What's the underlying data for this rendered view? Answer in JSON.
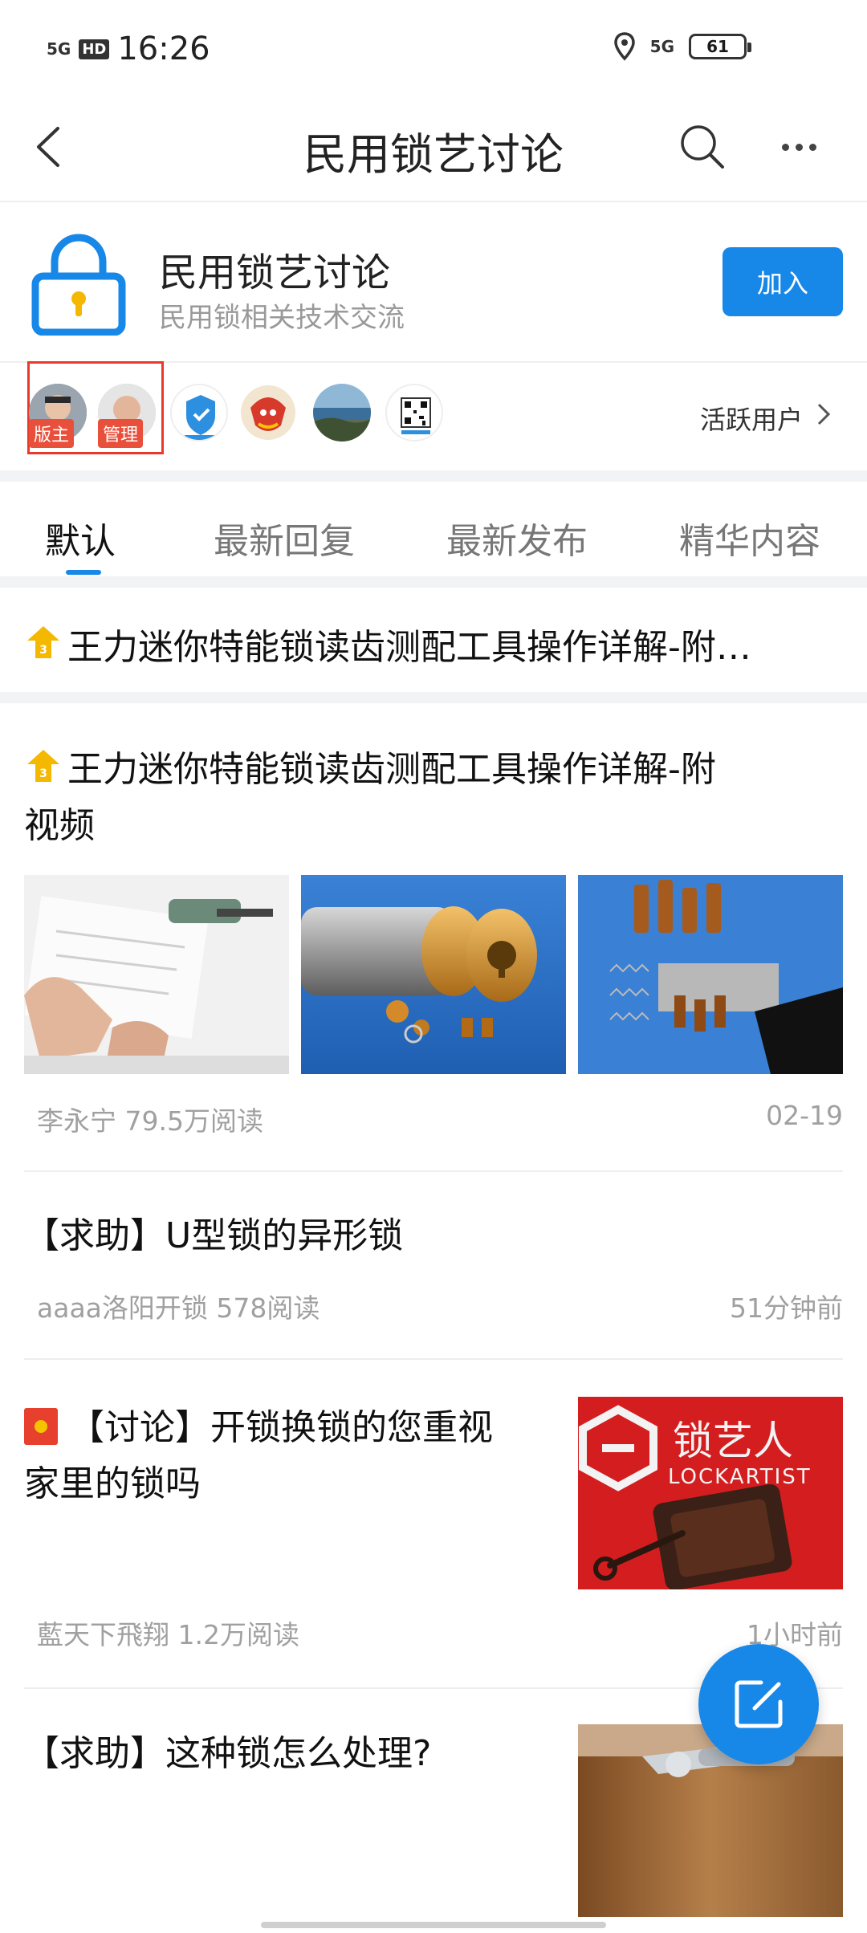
{
  "status_bar": {
    "signal_left": "5G",
    "hd": "HD",
    "time": "16:26",
    "signal_right": "5G",
    "battery": "61"
  },
  "nav": {
    "title": "民用锁艺讨论"
  },
  "forum": {
    "name": "民用锁艺讨论",
    "description": "民用锁相关技术交流",
    "join_label": "加入"
  },
  "users": {
    "moderator_badge": "版主",
    "admin_badge": "管理",
    "active_label": "活跃用户"
  },
  "tabs": [
    {
      "label": "默认",
      "active": true
    },
    {
      "label": "最新回复",
      "active": false
    },
    {
      "label": "最新发布",
      "active": false
    },
    {
      "label": "精华内容",
      "active": false
    }
  ],
  "pinned": {
    "title": "王力迷你特能锁读齿测配工具操作详解-附…"
  },
  "posts": [
    {
      "title_line1": "王力迷你特能锁读齿测配工具操作详解-附",
      "title_line2": "视频",
      "author_views": "李永宁 79.5万阅读",
      "time": "02-19"
    },
    {
      "title": "【求助】U型锁的异形锁",
      "author_views": "aaaa洛阳开锁 578阅读",
      "time": "51分钟前"
    },
    {
      "title_line1": "【讨论】开锁换锁的您重视",
      "title_line2": "家里的锁吗",
      "author_views": "藍天下飛翔 1.2万阅读",
      "time": "1小时前",
      "thumb_brand_cn": "锁艺人",
      "thumb_brand_en": "LOCKARTIST"
    },
    {
      "title": "【求助】这种锁怎么处理?"
    }
  ],
  "colors": {
    "accent": "#1787e8",
    "badge": "#e8503c",
    "pin": "#f5b800"
  }
}
